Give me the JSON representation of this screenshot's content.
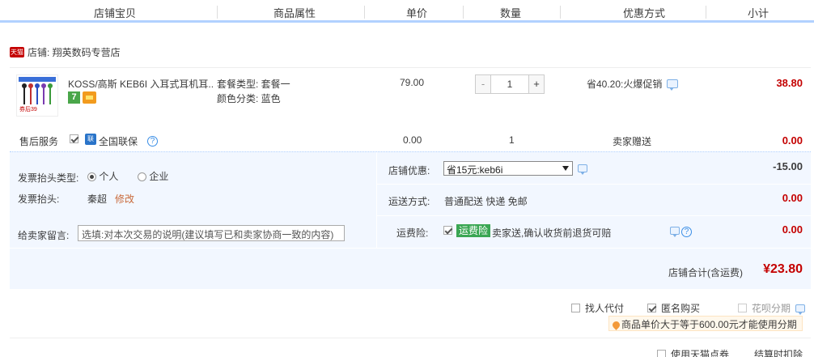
{
  "header": {
    "columns": [
      "店铺宝贝",
      "商品属性",
      "单价",
      "数量",
      "优惠方式",
      "小计"
    ]
  },
  "shop": {
    "badge": "天猫",
    "label": "店铺: 翔英数码专营店"
  },
  "item": {
    "title": "KOSS/高斯 KEB6I 入耳式耳机耳...",
    "thumb_price": "券后39",
    "badge_7": "7",
    "attr_package": "套餐类型: 套餐一",
    "attr_color": "颜色分类: 蓝色",
    "unit_price": "79.00",
    "qty_minus": "-",
    "qty_value": "1",
    "qty_plus": "+",
    "promo": "省40.20:火爆促销",
    "subtotal": "38.80"
  },
  "service": {
    "label": "售后服务",
    "shield": "联",
    "name": "全国联保",
    "help": "?",
    "price": "0.00",
    "qty": "1",
    "gift": "卖家赠送",
    "total": "0.00"
  },
  "invoice": {
    "type_label": "发票抬头类型:",
    "opt_personal": "个人",
    "opt_company": "企业",
    "title_label": "发票抬头:",
    "title_value": "秦超",
    "edit_link": "修改"
  },
  "message": {
    "label": "给卖家留言:",
    "placeholder": "选填:对本次交易的说明(建议填写已和卖家协商一致的内容)"
  },
  "shop_discount": {
    "label": "店铺优惠:",
    "selected": "省15元:keb6i",
    "amount": "-15.00"
  },
  "shipping": {
    "label": "运送方式:",
    "value": "普通配送 快递 免邮",
    "amount": "0.00"
  },
  "insurance": {
    "label": "运费险:",
    "badge": "运费险",
    "text": "卖家送,确认收货前退货可赔",
    "amount": "0.00"
  },
  "shop_total": {
    "label": "店铺合计(含运费)",
    "amount": "¥23.80"
  },
  "footer": {
    "proxy_pay": "找人代付",
    "anonymous": "匿名购买",
    "huabei": "花呗分期",
    "tip": "商品单价大于等于600.00元才能使用分期",
    "tmall_coupon": "使用天猫点券",
    "settle_partial": "结算时扣除"
  },
  "colors": {
    "accent_blue": "#b2d1ff",
    "price_red": "#c40000",
    "panel_bg": "#f2f7ff",
    "insurance_green": "#3aa653"
  }
}
